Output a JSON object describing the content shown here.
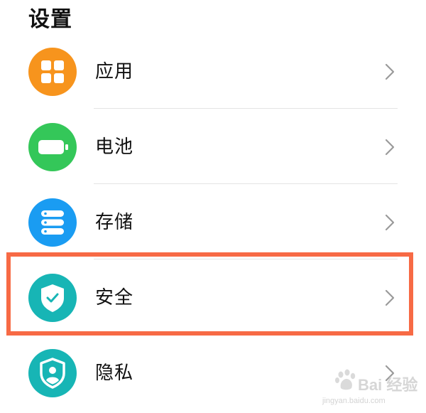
{
  "header": {
    "title": "设置"
  },
  "settings": {
    "items": [
      {
        "label": "应用",
        "icon": "apps-grid-icon",
        "color": "#f7941d"
      },
      {
        "label": "电池",
        "icon": "battery-icon",
        "color": "#34c759"
      },
      {
        "label": "存储",
        "icon": "storage-icon",
        "color": "#1a9cf2"
      },
      {
        "label": "安全",
        "icon": "shield-check-icon",
        "color": "#17b5b5"
      },
      {
        "label": "隐私",
        "icon": "privacy-shield-icon",
        "color": "#17b5b5"
      }
    ]
  },
  "annotation": {
    "highlight_color": "#f76a45",
    "highlighted_item": "安全"
  },
  "watermark": {
    "text": "Bai 经验",
    "subtext": "jingyan.baidu.com"
  }
}
